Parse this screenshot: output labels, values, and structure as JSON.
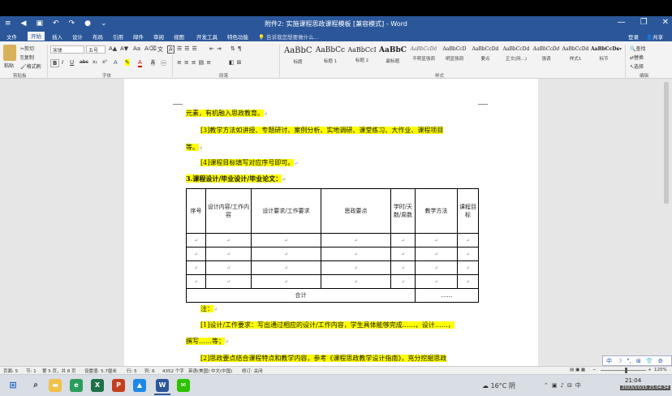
{
  "title": "附件2: 实施课程思政课程模板 [兼容模式] - Word",
  "quick_access": [
    "≡",
    "◀",
    "▣",
    "↶",
    "↷",
    "●",
    "⌄"
  ],
  "window_controls": [
    "—",
    "❐",
    "✕"
  ],
  "tabs": [
    "文件",
    "开始",
    "插入",
    "设计",
    "布局",
    "引用",
    "邮件",
    "审阅",
    "视图",
    "开发工具",
    "特色功能",
    "告诉我您想要做什么..."
  ],
  "account": [
    "登录",
    "共享"
  ],
  "ribbon": {
    "paste": "粘贴",
    "cut": "剪切",
    "copy": "复制",
    "format_painter": "格式刷",
    "font_name": "宋体",
    "font_size": "五号",
    "font_buttons": [
      "B",
      "I",
      "U",
      "abc",
      "x₂",
      "x²"
    ],
    "groups": [
      "剪贴板",
      "字体",
      "段落",
      "样式",
      "编辑"
    ],
    "styles": [
      {
        "sample": "AaBbC",
        "label": "标题"
      },
      {
        "sample": "AaBbCc",
        "label": "标题 1"
      },
      {
        "sample": "AaBbCcI",
        "label": "标题 2"
      },
      {
        "sample": "AaBbC",
        "label": "副标题"
      },
      {
        "sample": "AaBbCcDd",
        "label": "不明显强调"
      },
      {
        "sample": "AaBbCcD",
        "label": "明显强调"
      },
      {
        "sample": "AaBbCcDd",
        "label": "要点"
      },
      {
        "sample": "AaBbCcDd",
        "label": "正文(网...)"
      },
      {
        "sample": "AaBbCcDd",
        "label": "强调"
      },
      {
        "sample": "AaBbCcDd",
        "label": "样式1"
      },
      {
        "sample": "AaBbCcDc",
        "label": "标节"
      }
    ],
    "find": "查找",
    "replace": "替换",
    "select": "选择"
  },
  "document": {
    "lines": [
      "元素，有机融入思政教育。",
      "[3]教学方法如讲授、专题研讨、案例分析、实地调研、课堂练习、大作业、课程项目",
      "等。",
      "[4]课程目标填写对应序号即可。",
      "3.课程设计/毕业设计/毕业论文：",
      "注：",
      "[1]设计/工作要求：写出通过相应的设计/工作内容，学生具体能够完成……，设计……，",
      "撰写……等；",
      "[2]思政要点结合课程特点和教学内容，参考《课程思政教学设计指南》，充分挖掘思政"
    ],
    "para_mark": "↵",
    "table_headers": [
      "序号",
      "设计内容/工作内容",
      "设计要求/工作要求",
      "思政要点",
      "学时/天数/周数",
      "教学方法",
      "课程目标"
    ],
    "table_total": "合计",
    "table_total_value": "……"
  },
  "status": {
    "left": [
      "页面: 5",
      "节: 1",
      "第 5 页，共 8 页",
      "设置值: 5.7厘米",
      "行: 5",
      "列: 6",
      "4352 个字",
      "英语(美国)",
      "中文(中国)",
      "修订: 关闭"
    ],
    "zoom": "120%"
  },
  "ime": [
    "中",
    "☽",
    "°,",
    "⊞",
    "👕",
    "⚙"
  ],
  "taskbar": {
    "weather": "16°C 阴",
    "time": "21:04",
    "date": "2023/10/15 21:04:34"
  },
  "colors": {
    "word_blue": "#2b579a",
    "highlight": "#ffff00"
  }
}
